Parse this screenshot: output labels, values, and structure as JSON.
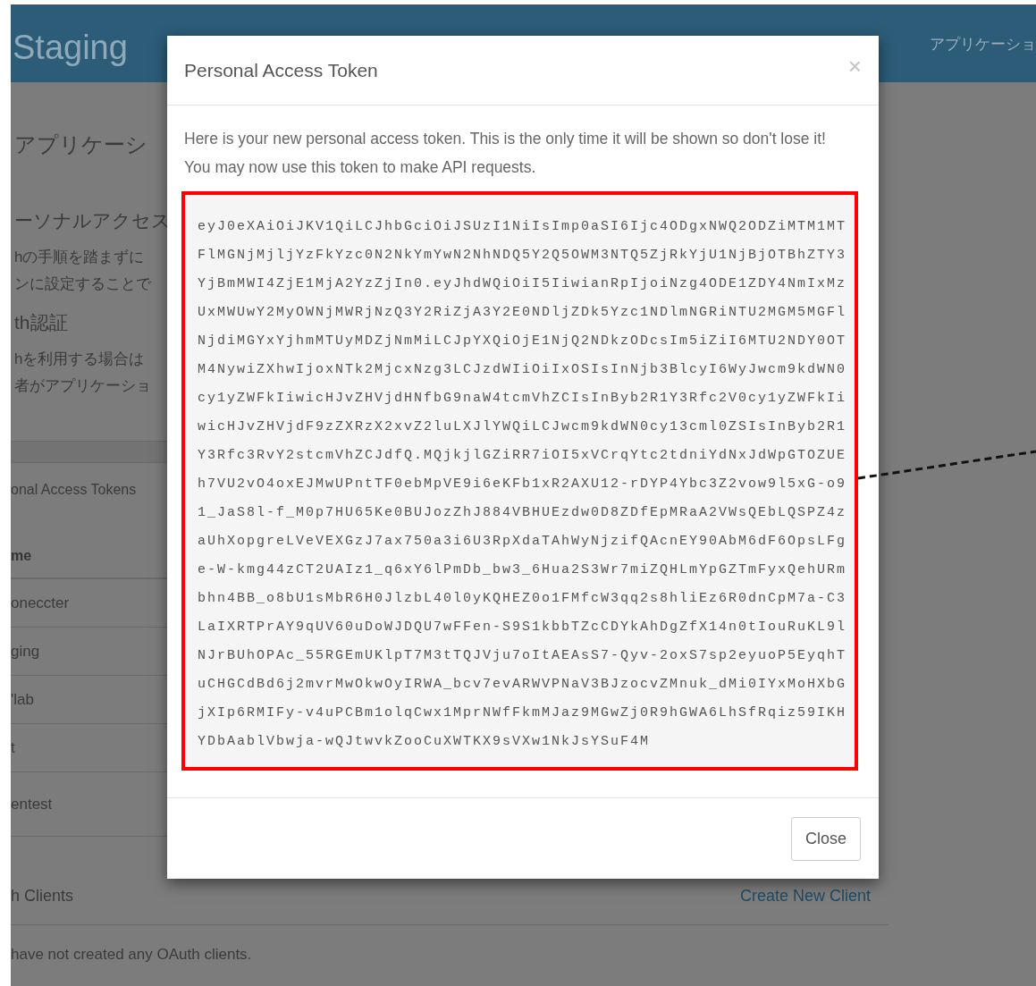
{
  "header": {
    "brand": "Staging",
    "nav_item": "アプリケーショ"
  },
  "page": {
    "title": "アプリケーシ",
    "sections": [
      {
        "heading": "ーソナルアクセス",
        "lines": [
          "hの手順を踏まずに",
          "ンに設定することで"
        ]
      },
      {
        "heading": "th認証",
        "lines": [
          "hを利用する場合は",
          "者がアプリケーショ"
        ]
      }
    ]
  },
  "tokens_panel": {
    "title": "onal Access Tokens",
    "column_1": "me",
    "rows": [
      "oneccter",
      "ging",
      "'lab",
      "t",
      "entest"
    ]
  },
  "clients_panel": {
    "title": "h Clients",
    "action": "Create New Client",
    "empty_message": "have not created any OAuth clients."
  },
  "modal": {
    "title": "Personal Access Token",
    "close": "×",
    "message": "Here is your new personal access token. This is the only time it will be shown so don't lose it! You may now use this token to make API requests.",
    "token_lines": [
      "eyJ0eXAiOiJKV1QiLCJhbGciOiJSUzI1NiIsImp0aSI6Ijc4ODgxNWQ2ODZiMTM1MT",
      "FlMGNjMjljYzFkYzc0N2NkYmYwN2NhNDQ5Y2Q5OWM3NTQ5ZjRkYjU1NjBjOTBhZTY3",
      "YjBmMWI4ZjE1MjA2YzZjIn0.eyJhdWQiOiI5IiwianRpIjoiNzg4ODE1ZDY4NmIxMz",
      "UxMWUwY2MyOWNjMWRjNzQ3Y2RiZjA3Y2E0NDljZDk5Yzc1NDlmNGRiNTU2MGM5MGFl",
      "NjdiMGYxYjhmMTUyMDZjNmMiLCJpYXQiOjE1NjQ2NDkzODcsIm5iZiI6MTU2NDY0OT",
      "M4NywiZXhwIjoxNTk2MjcxNzg3LCJzdWIiOiIxOSIsInNjb3BlcyI6WyJwcm9kdWN0",
      "cy1yZWFkIiwicHJvZHVjdHNfbG9naW4tcmVhZCIsInByb2R1Y3Rfc2V0cy1yZWFkIi",
      "wicHJvZHVjdF9zZXRzX2xvZ2luLXJlYWQiLCJwcm9kdWN0cy13cml0ZSIsInByb2R1",
      "Y3Rfc3RvY2stcmVhZCJdfQ.MQjkjlGZiRR7iOI5xVCrqYtc2tdniYdNxJdWpGTOZUE",
      "h7VU2vO4oxEJMwUPntTF0ebMpVE9i6eKFb1xR2AXU12-rDYP4Ybc3Z2vow9l5xG-o9",
      "1_JaS8l-f_M0p7HU65Ke0BUJozZhJ884VBHUEzdw0D8ZDfEpMRaA2VWsQEbLQSPZ4z",
      "aUhXopgreLVeVEXGzJ7ax750a3i6U3RpXdaTAhWyNjzifQAcnEY90AbM6dF6OpsLFg",
      "e-W-kmg44zCT2UAIz1_q6xY6lPmDb_bw3_6Hua2S3Wr7miZQHLmYpGZTmFyxQehURm",
      "bhn4BB_o8bU1sMbR6H0JlzbL40l0yKQHEZ0o1FMfcW3qq2s8hliEz6R0dnCpM7a-C3",
      "LaIXRTPrAY9qUV60uDoWJDQU7wFFen-S9S1kbbTZcCDYkAhDgZfX14n0tIouRuKL9l",
      "NJrBUhOPAc_55RGEmUKlpT7M3tTQJVju7oItAEAsS7-Qyv-2oxS7sp2eyuoP5EyqhT",
      "uCHGCdBd6j2mvrMwOkwOyIRWA_bcv7evARWVPNaV3BJzocvZMnuk_dMi0IYxMoHXbG",
      "jXIp6RMIFy-v4uPCBm1olqCwx1MprNWfFkmMJaz9MGwZj0R9hGWA6LhSfRqiz59IKH",
      "YDbAablVbwja-wQJtwvkZooCuXWTKX9sVXw1NkJsYSuF4M"
    ],
    "button": "Close"
  }
}
